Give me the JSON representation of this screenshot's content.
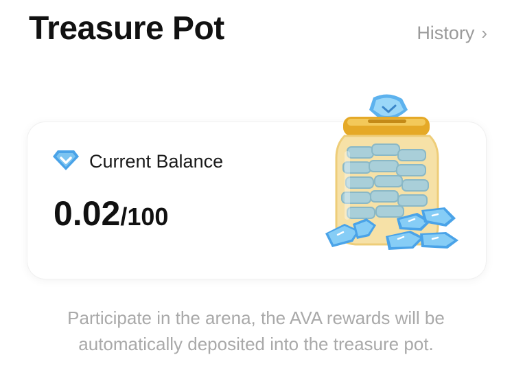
{
  "header": {
    "title": "Treasure Pot",
    "history_label": "History"
  },
  "balance": {
    "label": "Current Balance",
    "current": "0.02",
    "max": "/100"
  },
  "note": {
    "line1": "Participate in the arena, the AVA rewards will be",
    "line2": "automatically deposited into the treasure pot."
  },
  "icons": {
    "balance": "diamond-gem-icon",
    "history": "chevron-right-icon",
    "illustration": "treasure-jar-icon"
  },
  "colors": {
    "gem": "#4aa3e8",
    "gem_light": "#8fd0f7",
    "lid": "#e2a62a",
    "muted_text": "#a9a9a9"
  }
}
